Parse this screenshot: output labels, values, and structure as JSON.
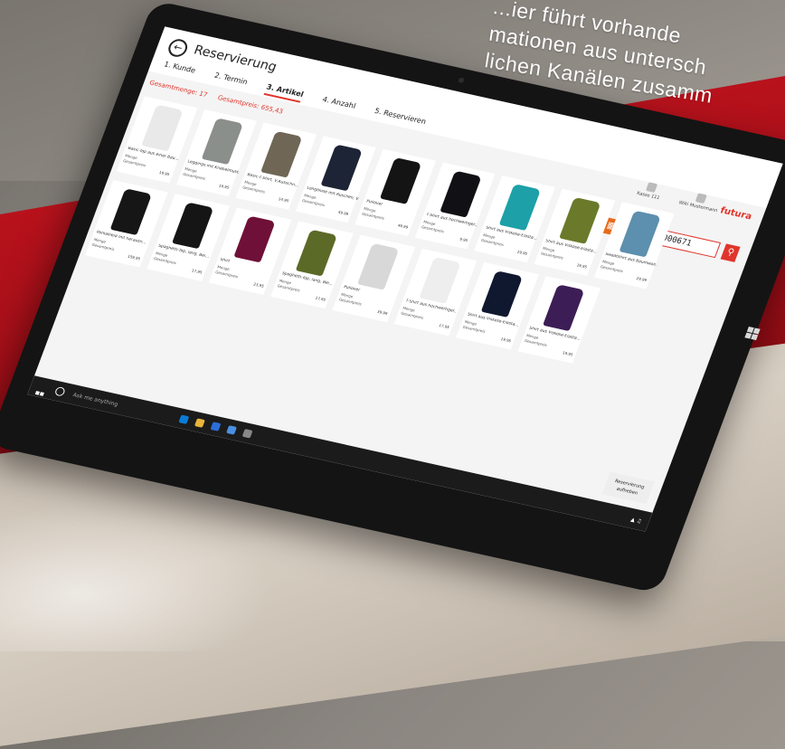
{
  "headline": {
    "line1": "...ier führt vorhande",
    "line2": "mationen aus untersch",
    "line3": "lichen Kanälen zusamm"
  },
  "app": {
    "title": "Reservierung",
    "steps": [
      {
        "label": "1. Kunde",
        "active": false
      },
      {
        "label": "2. Termin",
        "active": false
      },
      {
        "label": "3. Artikel",
        "active": true
      },
      {
        "label": "4. Anzahl",
        "active": false
      },
      {
        "label": "5. Reservieren",
        "active": false
      }
    ],
    "summary": {
      "count": "Gesamtmenge: 17",
      "total": "Gesamtpreis: 655,43"
    },
    "top_actions": [
      {
        "label": "Kasse 111",
        "icon": "register-icon"
      },
      {
        "label": "Wiki Mustermann",
        "icon": "user-icon"
      }
    ],
    "brand": "futura",
    "search_value": "4056378000671",
    "reserve_button": "Reservierung aufheben",
    "taskbar_search": "Ask me anything"
  },
  "products": [
    [
      {
        "name": "Basic-Top aus einer Bau...",
        "color": "#e9e9e9",
        "price": "19,95"
      },
      {
        "name": "Leggings mit Knebelmust...",
        "color": "#8b8f8c",
        "price": "19,95"
      },
      {
        "name": "Basic-T-Shirt, V-Ausschn...",
        "color": "#6f6656",
        "price": "14,95"
      },
      {
        "name": "Longbluse mit Rüschen, V-...",
        "color": "#1d2435",
        "price": "49,99"
      },
      {
        "name": "Pullover",
        "color": "#141414",
        "price": "49,99"
      },
      {
        "name": "T-Shirt aus hochwertiger...",
        "color": "#101015",
        "price": "9,95"
      },
      {
        "name": "Shirt aus Viskose-Elasta...",
        "color": "#1da0a8",
        "price": "19,95"
      },
      {
        "name": "Shirt aus Viskose-Elasta...",
        "color": "#6a7a2a",
        "price": "19,95"
      },
      {
        "name": "Sweatshirt aus Baumwoll...",
        "color": "#5d8fae",
        "price": "29,99"
      }
    ],
    [
      {
        "name": "Parkakleid mit herausn...",
        "color": "#161616",
        "price": "159,95"
      },
      {
        "name": "Spaghetti-Top, lang, Bei...",
        "color": "#151515",
        "price": "17,95"
      },
      {
        "name": "Shirt",
        "color": "#6f1038",
        "price": "23,95"
      },
      {
        "name": "Spaghetti-Top, lang, Bei...",
        "color": "#5c6a28",
        "price": "17,95"
      },
      {
        "name": "Pullover",
        "color": "#d8d8d8",
        "price": "39,99"
      },
      {
        "name": "T-Shirt aus hochwertiger...",
        "color": "#eeeeee",
        "price": "17,95"
      },
      {
        "name": "Shirt aus Viskose-Elasta...",
        "color": "#101830",
        "price": "19,95"
      },
      {
        "name": "Shirt aus Viskose-Elasta...",
        "color": "#3d1d56",
        "price": "19,95"
      }
    ]
  ],
  "labels": {
    "menge": "Menge",
    "gesamtpreis": "Gesamtpreis"
  }
}
